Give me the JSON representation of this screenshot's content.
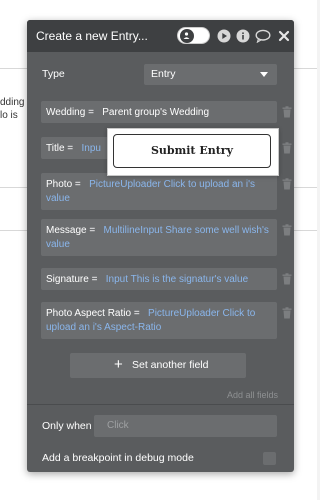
{
  "background": {
    "left_text": [
      "dding",
      "lo is"
    ]
  },
  "dialog": {
    "title": "Create a new Entry...",
    "type_label": "Type",
    "type_value": "Entry",
    "fields": [
      {
        "key": "Wedding",
        "sep": " = ",
        "dynamic": "",
        "static": "Parent group's Wedding"
      },
      {
        "key": "Title",
        "sep": " = ",
        "dynamic": "Inpu",
        "static": ""
      },
      {
        "key": "Photo",
        "sep": " = ",
        "dynamic": "PictureUploader Click to upload an i's value",
        "static": ""
      },
      {
        "key": "Message",
        "sep": " = ",
        "dynamic": "MultilineInput Share some well wish's value",
        "static": ""
      },
      {
        "key": "Signature",
        "sep": " = ",
        "dynamic": "Input This is the signatur's value",
        "static": ""
      },
      {
        "key": "Photo Aspect Ratio",
        "sep": " = ",
        "dynamic": "PictureUploader Click to upload an i's Aspect-Ratio",
        "static": ""
      }
    ],
    "submit_popup_label": "Submit Entry",
    "set_field_label": "Set another field",
    "add_all_label": "Add all fields",
    "only_when_label": "Only when",
    "only_when_placeholder": "Click",
    "breakpoint_label": "Add a breakpoint in debug mode"
  },
  "colors": {
    "dialog_bg": "#5a5c5e",
    "header_bg": "#3e4042",
    "field_bg": "#6b6d6f",
    "dynamic_text": "#8ab6ec",
    "accent_line": "#f0a32e"
  },
  "icons": [
    "play-icon",
    "info-icon",
    "comment-icon",
    "close-icon",
    "trash-icon",
    "plus-icon",
    "caret-down-icon"
  ]
}
